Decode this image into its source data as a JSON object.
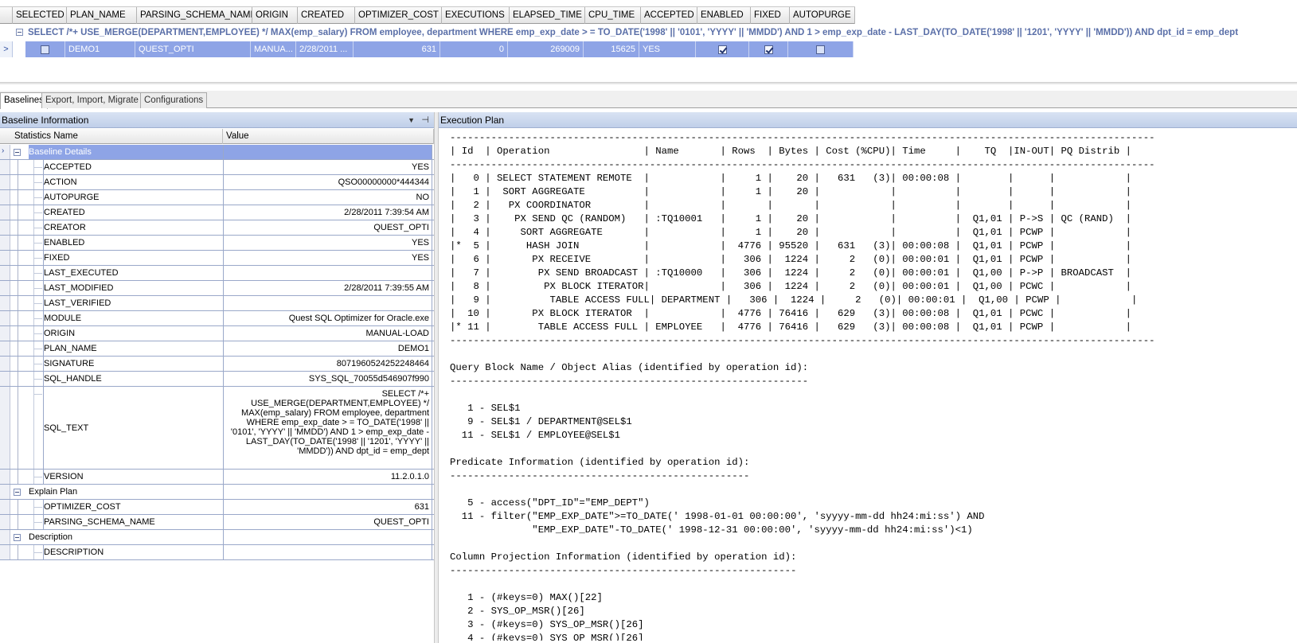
{
  "top_grid": {
    "columns": [
      {
        "label": "SELECTED",
        "w": 68
      },
      {
        "label": "PLAN_NAME",
        "w": 88
      },
      {
        "label": "PARSING_SCHEMA_NAME",
        "w": 145
      },
      {
        "label": "ORIGIN",
        "w": 57
      },
      {
        "label": "CREATED",
        "w": 72
      },
      {
        "label": "OPTIMIZER_COST",
        "w": 109
      },
      {
        "label": "EXECUTIONS",
        "w": 85
      },
      {
        "label": "ELAPSED_TIME",
        "w": 95
      },
      {
        "label": "CPU_TIME",
        "w": 70
      },
      {
        "label": "ACCEPTED",
        "w": 71
      },
      {
        "label": "ENABLED",
        "w": 67
      },
      {
        "label": "FIXED",
        "w": 49
      },
      {
        "label": "AUTOPURGE",
        "w": 82
      }
    ],
    "group_text": "SELECT /*+ USE_MERGE(DEPARTMENT,EMPLOYEE) */   MAX(emp_salary) FROM employee, department WHERE emp_exp_date > = TO_DATE('1998' || '0101', 'YYYY' || 'MMDD') AND 1 > emp_exp_date - LAST_DAY(TO_DATE('1998' || '1201', 'YYYY' || 'MMDD')) AND dpt_id = emp_dept",
    "row": {
      "row_indicator": ">",
      "plan_name": "DEMO1",
      "parsing_schema_name": "QUEST_OPTI",
      "origin": "MANUA...",
      "created": "2/28/2011 ...",
      "optimizer_cost": "631",
      "executions": "0",
      "elapsed_time": "269009",
      "cpu_time": "15625",
      "accepted": "YES"
    }
  },
  "tabs": [
    "Baselines",
    "Export, Import, Migrate",
    "Configurations"
  ],
  "left_panel": {
    "title": "Baseline Information",
    "col_name": "Statistics Name",
    "col_value": "Value",
    "baseline_details_label": "Baseline Details",
    "details": [
      {
        "name": "ACCEPTED",
        "value": "YES"
      },
      {
        "name": "ACTION",
        "value": "QSO00000000*444344"
      },
      {
        "name": "AUTOPURGE",
        "value": "NO"
      },
      {
        "name": "CREATED",
        "value": "2/28/2011 7:39:54 AM"
      },
      {
        "name": "CREATOR",
        "value": "QUEST_OPTI"
      },
      {
        "name": "ENABLED",
        "value": "YES"
      },
      {
        "name": "FIXED",
        "value": "YES"
      },
      {
        "name": "LAST_EXECUTED",
        "value": ""
      },
      {
        "name": "LAST_MODIFIED",
        "value": "2/28/2011 7:39:55 AM"
      },
      {
        "name": "LAST_VERIFIED",
        "value": ""
      },
      {
        "name": "MODULE",
        "value": "Quest SQL Optimizer for Oracle.exe"
      },
      {
        "name": "ORIGIN",
        "value": "MANUAL-LOAD"
      },
      {
        "name": "PLAN_NAME",
        "value": "DEMO1"
      },
      {
        "name": "SIGNATURE",
        "value": "8071960524252248464"
      },
      {
        "name": "SQL_HANDLE",
        "value": "SYS_SQL_70055d546907f990"
      }
    ],
    "sql_text_name": "SQL_TEXT",
    "sql_text_value": "SELECT /*+ USE_MERGE(DEPARTMENT,EMPLOYEE) */ MAX(emp_salary) FROM employee, department WHERE emp_exp_date > = TO_DATE('1998' || '0101', 'YYYY' || 'MMDD') AND 1 > emp_exp_date - LAST_DAY(TO_DATE('1998' || '1201', 'YYYY' || 'MMDD')) AND dpt_id = emp_dept",
    "version_name": "VERSION",
    "version_value": "11.2.0.1.0",
    "explain_plan_label": "Explain Plan",
    "explain": [
      {
        "name": "OPTIMIZER_COST",
        "value": "631"
      },
      {
        "name": "PARSING_SCHEMA_NAME",
        "value": "QUEST_OPTI"
      }
    ],
    "description_label": "Description",
    "description": [
      {
        "name": "DESCRIPTION",
        "value": ""
      }
    ]
  },
  "right_panel": {
    "title": "Execution Plan",
    "plan_text": "------------------------------------------------------------------------------------------------------------------------\n| Id  | Operation                | Name       | Rows  | Bytes | Cost (%CPU)| Time     |    TQ  |IN-OUT| PQ Distrib |\n------------------------------------------------------------------------------------------------------------------------\n|   0 | SELECT STATEMENT REMOTE  |            |     1 |    20 |   631   (3)| 00:00:08 |        |      |            |\n|   1 |  SORT AGGREGATE          |            |     1 |    20 |            |          |        |      |            |\n|   2 |   PX COORDINATOR         |            |       |       |            |          |        |      |            |\n|   3 |    PX SEND QC (RANDOM)   | :TQ10001   |     1 |    20 |            |          |  Q1,01 | P->S | QC (RAND)  |\n|   4 |     SORT AGGREGATE       |            |     1 |    20 |            |          |  Q1,01 | PCWP |            |\n|*  5 |      HASH JOIN           |            |  4776 | 95520 |   631   (3)| 00:00:08 |  Q1,01 | PCWP |            |\n|   6 |       PX RECEIVE         |            |   306 |  1224 |     2   (0)| 00:00:01 |  Q1,01 | PCWP |            |\n|   7 |        PX SEND BROADCAST | :TQ10000   |   306 |  1224 |     2   (0)| 00:00:01 |  Q1,00 | P->P | BROADCAST  |\n|   8 |         PX BLOCK ITERATOR|            |   306 |  1224 |     2   (0)| 00:00:01 |  Q1,00 | PCWC |            |\n|   9 |          TABLE ACCESS FULL| DEPARTMENT |   306 |  1224 |     2   (0)| 00:00:01 |  Q1,00 | PCWP |            |\n|  10 |       PX BLOCK ITERATOR  |            |  4776 | 76416 |   629   (3)| 00:00:08 |  Q1,01 | PCWC |            |\n|* 11 |        TABLE ACCESS FULL | EMPLOYEE   |  4776 | 76416 |   629   (3)| 00:00:08 |  Q1,01 | PCWP |            |\n------------------------------------------------------------------------------------------------------------------------\n\nQuery Block Name / Object Alias (identified by operation id):\n-------------------------------------------------------------\n\n   1 - SEL$1\n   9 - SEL$1 / DEPARTMENT@SEL$1\n  11 - SEL$1 / EMPLOYEE@SEL$1\n\nPredicate Information (identified by operation id):\n---------------------------------------------------\n\n   5 - access(\"DPT_ID\"=\"EMP_DEPT\")\n  11 - filter(\"EMP_EXP_DATE\">=TO_DATE(' 1998-01-01 00:00:00', 'syyyy-mm-dd hh24:mi:ss') AND\n              \"EMP_EXP_DATE\"-TO_DATE(' 1998-12-31 00:00:00', 'syyyy-mm-dd hh24:mi:ss')<1)\n\nColumn Projection Information (identified by operation id):\n-----------------------------------------------------------\n\n   1 - (#keys=0) MAX()[22]\n   2 - SYS_OP_MSR()[26]\n   3 - (#keys=0) SYS_OP_MSR()[26]\n   4 - (#keys=0) SYS_OP_MSR()[26]"
  }
}
